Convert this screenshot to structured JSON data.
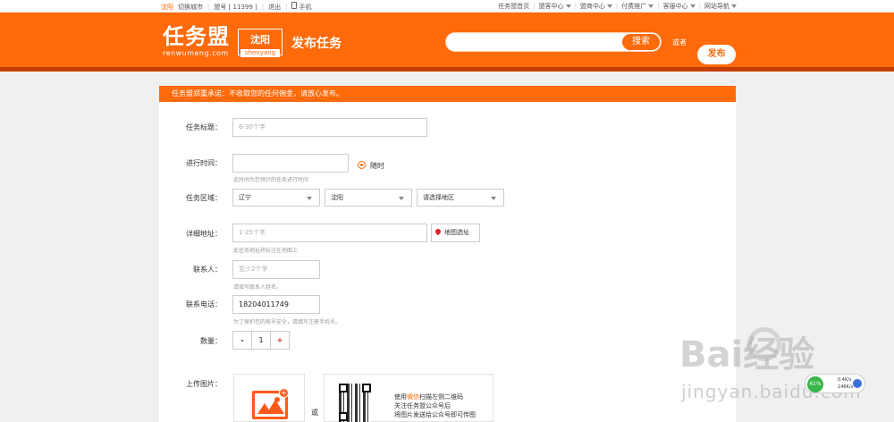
{
  "topbar": {
    "city": "沈阳",
    "switch_city": "切换城市",
    "account": "盟号 [ 11399 ]",
    "logout": "退出",
    "mobile": "手机",
    "home": "任务盟首页",
    "user_center": "盟客中心",
    "merchant_center": "盟商中心",
    "paid_promo": "付费推广",
    "service_center": "客服中心",
    "site_nav": "网站导航"
  },
  "header": {
    "logo_cn": "任务盟",
    "logo_en": "renwumeng.com",
    "city_cn": "沈阳",
    "city_en": "shenyang",
    "title": "发布任务",
    "search_placeholder": "",
    "search_button": "搜索",
    "or_text": "或者",
    "publish_button": "发布"
  },
  "notice": "任务盟郑重承诺：不收取您的任何佣金，请放心发布。",
  "form": {
    "title_label": "任务标题：",
    "title_placeholder": "6-30个字",
    "time_label": "进行时间：",
    "time_value": "",
    "time_option": "随时",
    "time_hint": "此时间为您预计的任务进行时间",
    "area_label": "任务区域：",
    "province": "辽宁",
    "city": "沈阳",
    "district": "请选择地区",
    "address_label": "详细地址：",
    "address_placeholder": "1-25个字",
    "map_button": "地图选址",
    "address_hint": "此任务地址将标注在地图上",
    "contact_label": "联系人：",
    "contact_placeholder": "至少2个字",
    "contact_hint": "请填写联系人姓名。",
    "phone_label": "联系电话：",
    "phone_value": "18204011749",
    "phone_hint": "为了保护您的帐号安全，请填写注册手机号。",
    "qty_label": "数量：",
    "qty_minus": "-",
    "qty_value": "1",
    "qty_plus": "+",
    "upload_label": "上传图片：",
    "or": "或",
    "qr_line1_prefix": "使用",
    "qr_line1_wechat": "微信",
    "qr_line1_suffix": "扫描左侧二维码",
    "qr_line2": "关注任务盟公众号后",
    "qr_line3": "将图片发送给公众号即可传图"
  },
  "overlay": {
    "watermark": "Bai经验",
    "watermark_url": "jingyan.baidu.com",
    "net_percent": "61%",
    "net_up": "0.4K/s",
    "net_down": "146K/s"
  },
  "colors": {
    "brand": "#ff6a0a",
    "brand_dark": "#c63c00",
    "accent_red": "#e02020"
  }
}
